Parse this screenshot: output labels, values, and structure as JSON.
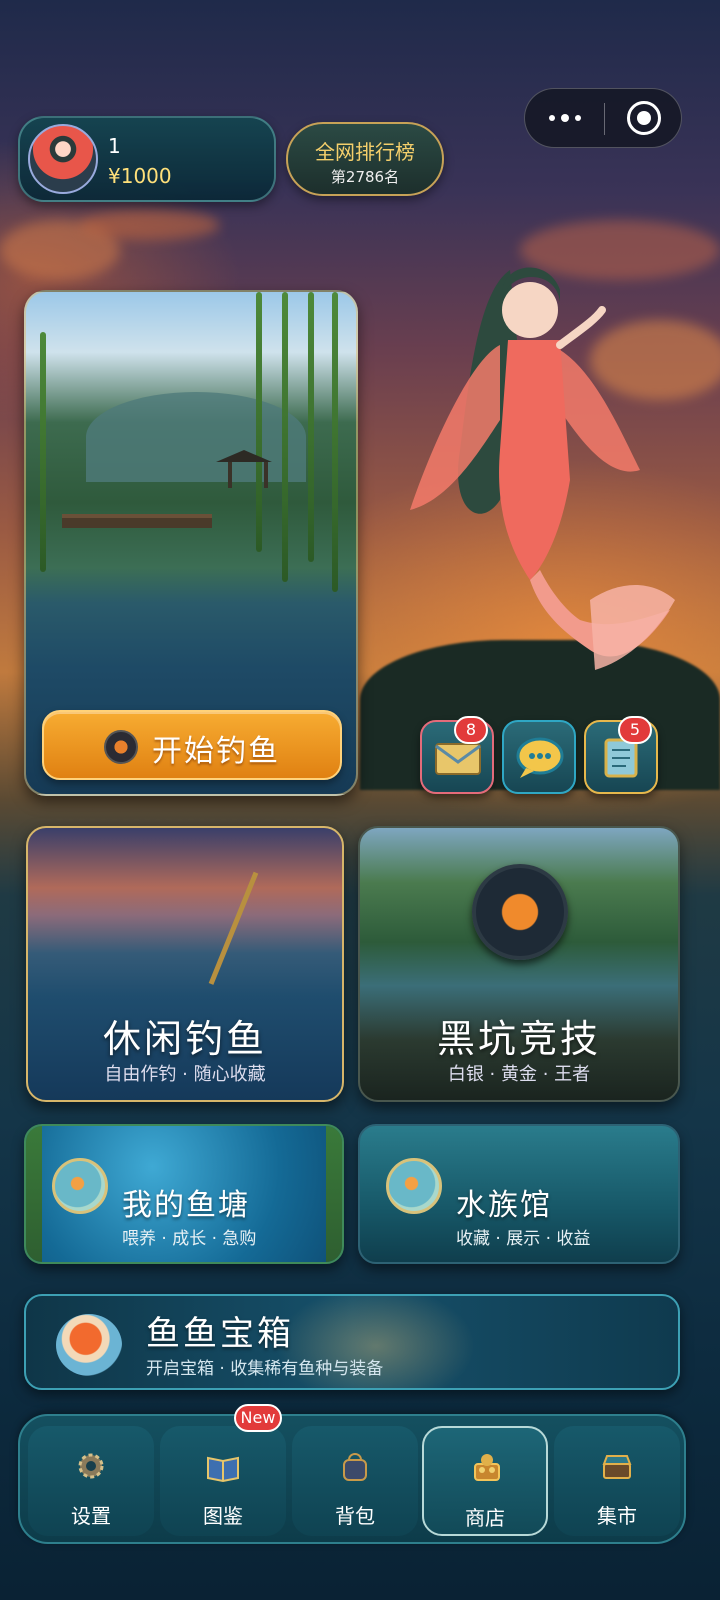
{
  "player": {
    "level": "1",
    "money": "¥1000"
  },
  "rank": {
    "title": "全网排行榜",
    "position": "第2786名"
  },
  "start_fishing": {
    "label": "开始钓鱼"
  },
  "quick_icons": [
    {
      "name": "mail",
      "badge": "8"
    },
    {
      "name": "chat",
      "badge": ""
    },
    {
      "name": "scroll",
      "badge": "5"
    }
  ],
  "modes": {
    "leisure": {
      "title": "休闲钓鱼",
      "subtitle": "自由作钓 · 随心收藏"
    },
    "pit": {
      "title": "黑坑竞技",
      "subtitle": "白银 · 黄金 · 王者"
    }
  },
  "pond": {
    "title": "我的鱼塘",
    "subtitle": "喂养 · 成长 · 急购"
  },
  "aquarium": {
    "title": "水族馆",
    "subtitle": "收藏 · 展示 · 收益"
  },
  "chest": {
    "title": "鱼鱼宝箱",
    "subtitle": "开启宝箱 · 收集稀有鱼种与装备"
  },
  "nav": {
    "items": [
      {
        "label": "设置",
        "icon": "settings-icon"
      },
      {
        "label": "图鉴",
        "icon": "book-icon"
      },
      {
        "label": "背包",
        "icon": "backpack-icon"
      },
      {
        "label": "商店",
        "icon": "shop-icon"
      },
      {
        "label": "集市",
        "icon": "market-icon"
      }
    ],
    "new_badge": "New"
  },
  "colors": {
    "accent_orange": "#f7ac32",
    "gold": "#f5cf6b",
    "badge_red": "#e23a3a",
    "teal": "#145060"
  }
}
